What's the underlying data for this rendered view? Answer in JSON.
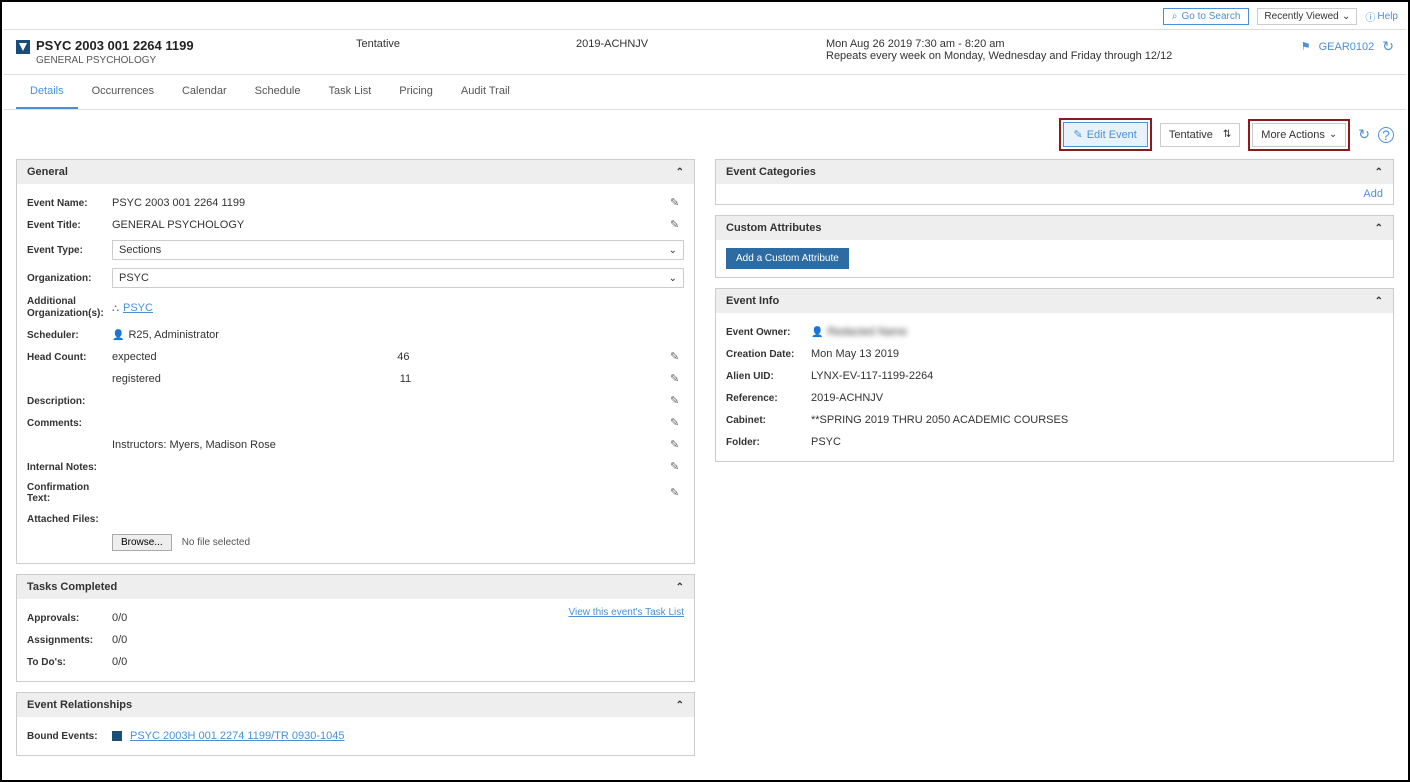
{
  "topbar": {
    "go_to_search": "Go to Search",
    "recently_viewed": "Recently Viewed",
    "help": "Help"
  },
  "header": {
    "title": "PSYC 2003 001 2264 1199",
    "subtitle": "GENERAL PSYCHOLOGY",
    "status": "Tentative",
    "reference": "2019-ACHNJV",
    "time": "Mon Aug 26 2019 7:30 am - 8:20 am",
    "repeats": "Repeats every week on Monday, Wednesday and Friday through 12/12",
    "location": "GEAR0102"
  },
  "tabs": [
    "Details",
    "Occurrences",
    "Calendar",
    "Schedule",
    "Task List",
    "Pricing",
    "Audit Trail"
  ],
  "toolbar": {
    "edit_event": "Edit Event",
    "status": "Tentative",
    "more_actions": "More Actions"
  },
  "general": {
    "title": "General",
    "event_name_label": "Event Name:",
    "event_name": "PSYC 2003 001 2264 1199",
    "event_title_label": "Event Title:",
    "event_title": "GENERAL PSYCHOLOGY",
    "event_type_label": "Event Type:",
    "event_type": "Sections",
    "organization_label": "Organization:",
    "organization": "PSYC",
    "additional_org_label": "Additional Organization(s):",
    "additional_org": "PSYC",
    "scheduler_label": "Scheduler:",
    "scheduler": "R25, Administrator",
    "head_count_label": "Head Count:",
    "expected_label": "expected",
    "expected_value": "46",
    "registered_label": "registered",
    "registered_value": "11",
    "description_label": "Description:",
    "comments_label": "Comments:",
    "comments": "Instructors: Myers, Madison Rose",
    "internal_notes_label": "Internal Notes:",
    "confirmation_text_label": "Confirmation Text:",
    "attached_files_label": "Attached Files:",
    "browse": "Browse...",
    "no_file": "No file selected"
  },
  "tasks_completed": {
    "title": "Tasks Completed",
    "approvals_label": "Approvals:",
    "approvals": "0/0",
    "assignments_label": "Assignments:",
    "assignments": "0/0",
    "todos_label": "To Do's:",
    "todos": "0/0",
    "view_link": "View this event's Task List"
  },
  "event_relationships": {
    "title": "Event Relationships",
    "bound_events_label": "Bound Events:",
    "bound_event": "PSYC 2003H 001 2274 1199/TR 0930-1045"
  },
  "event_categories": {
    "title": "Event Categories",
    "add": "Add"
  },
  "custom_attributes": {
    "title": "Custom Attributes",
    "add_button": "Add a Custom Attribute"
  },
  "event_info": {
    "title": "Event Info",
    "owner_label": "Event Owner:",
    "owner": "Redacted Name",
    "creation_date_label": "Creation Date:",
    "creation_date": "Mon May 13 2019",
    "alien_uid_label": "Alien UID:",
    "alien_uid": "LYNX-EV-117-1199-2264",
    "reference_label": "Reference:",
    "reference": "2019-ACHNJV",
    "cabinet_label": "Cabinet:",
    "cabinet": "**SPRING 2019 THRU 2050 ACADEMIC COURSES",
    "folder_label": "Folder:",
    "folder": "PSYC"
  }
}
